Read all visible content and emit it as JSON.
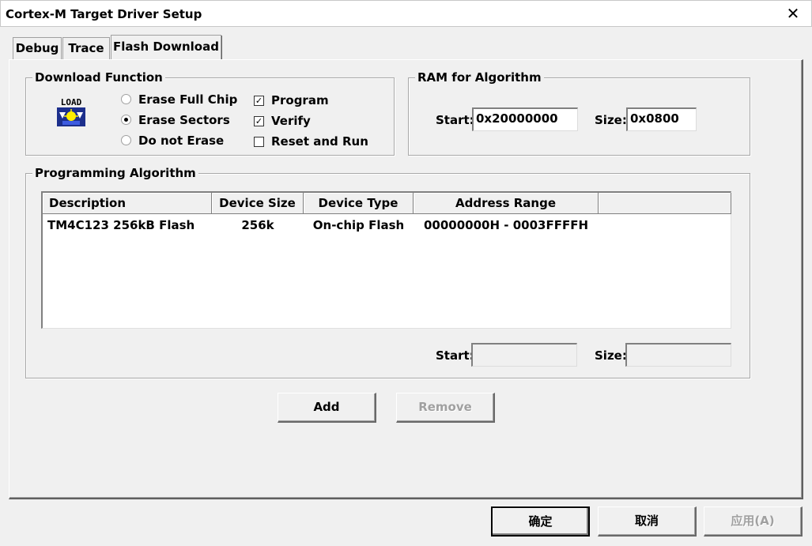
{
  "window": {
    "title": "Cortex-M Target Driver Setup",
    "close_glyph": "✕"
  },
  "tabs": [
    {
      "label": "Debug",
      "active": false
    },
    {
      "label": "Trace",
      "active": false
    },
    {
      "label": "Flash Download",
      "active": true
    }
  ],
  "download_function": {
    "label": "Download Function",
    "icon": "load-icon",
    "icon_text": "LOAD",
    "erase_options": [
      {
        "label": "Erase Full Chip",
        "selected": false
      },
      {
        "label": "Erase Sectors",
        "selected": true
      },
      {
        "label": "Do not Erase",
        "selected": false
      }
    ],
    "checks": [
      {
        "label": "Program",
        "checked": true
      },
      {
        "label": "Verify",
        "checked": true
      },
      {
        "label": "Reset and Run",
        "checked": false
      }
    ]
  },
  "ram_for_algorithm": {
    "label": "RAM for Algorithm",
    "start_label": "Start:",
    "start_value": "0x20000000",
    "size_label": "Size:",
    "size_value": "0x0800"
  },
  "programming_algorithm": {
    "label": "Programming Algorithm",
    "columns": [
      "Description",
      "Device Size",
      "Device Type",
      "Address Range"
    ],
    "rows": [
      {
        "description": "TM4C123 256kB Flash",
        "device_size": "256k",
        "device_type": "On-chip Flash",
        "address_range": "00000000H - 0003FFFFH"
      }
    ],
    "start_label": "Start:",
    "start_value": "",
    "size_label": "Size:",
    "size_value": ""
  },
  "buttons": {
    "add": "Add",
    "remove": "Remove"
  },
  "footer": {
    "ok": "确定",
    "cancel": "取消",
    "apply": "应用(A)"
  },
  "colors": {
    "background": "#f0f0f0",
    "disabled_text": "#a0a0a0"
  }
}
